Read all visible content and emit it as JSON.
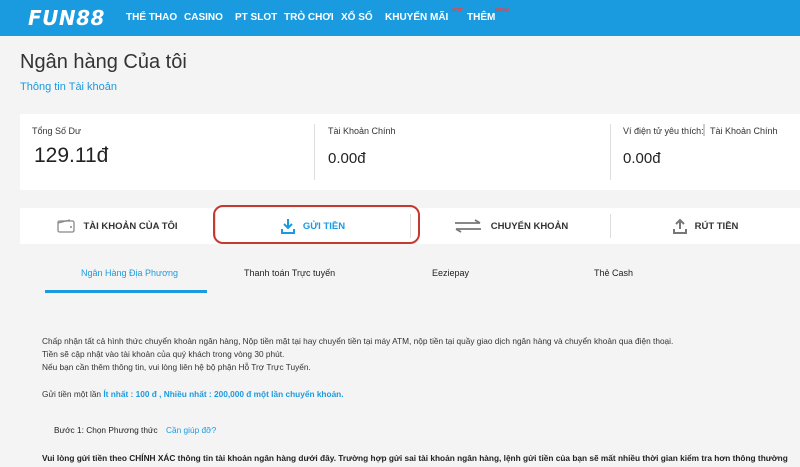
{
  "brand": {
    "logo_text": "FUN88",
    "accent": "#1a9be0",
    "highlight": "#c43a2e"
  },
  "nav": {
    "items": [
      {
        "label": "THỂ THAO"
      },
      {
        "label": "CASINO"
      },
      {
        "label": "PT SLOT"
      },
      {
        "label": "TRÒ CHƠI"
      },
      {
        "label": "XỔ SỐ"
      },
      {
        "label": "KHUYẾN MÃI",
        "badge": "HOT"
      },
      {
        "label": "THÊM",
        "badge": "NEW!"
      }
    ]
  },
  "header": {
    "title": "Ngân hàng Của tôi",
    "subtitle": "Thông tin Tài khoản"
  },
  "balances": {
    "total": {
      "label": "Tổng Số Dư",
      "value": "129.11đ"
    },
    "main": {
      "label": "Tài Khoản Chính",
      "value": "0.00đ"
    },
    "wallet": {
      "label": "Ví điện tử yêu thích:",
      "selected": "Tài Khoản Chính",
      "value": "0.00đ"
    }
  },
  "main_tabs": [
    {
      "label": "TÀI KHOẢN CỦA TÔI",
      "icon": "wallet-icon"
    },
    {
      "label": "GỬI TIỀN",
      "icon": "download-icon",
      "active": true
    },
    {
      "label": "CHUYỂN KHOẢN",
      "icon": "transfer-arrows-icon"
    },
    {
      "label": "RÚT TIỀN",
      "icon": "upload-icon"
    }
  ],
  "sub_tabs": [
    {
      "label": "Ngân Hàng Địa Phương",
      "active": true
    },
    {
      "label": "Thanh toán Trực tuyến"
    },
    {
      "label": "Eeziepay"
    },
    {
      "label": "Thẻ Cash"
    }
  ],
  "content": {
    "line1": "Chấp nhận tất cả hình thức chuyển khoản ngân hàng, Nộp tiền mặt tại hay chuyển tiền tại máy ATM, nộp tiền tại quầy giao dịch ngân hàng và chuyển khoản qua điện thoại.",
    "line2": "Tiền sẽ cập nhật vào tài khoản của quý khách trong vòng 30 phút.",
    "line3": "Nếu bạn cần thêm thông tin, vui lòng liên hệ bộ phận Hỗ Trợ Trực Tuyến.",
    "limit_prefix": "Gửi tiền một lần",
    "limit_value": "Ít nhất : 100 đ , Nhiều nhất : 200,000 đ một lần chuyển khoản.",
    "step_label": "Bước 1: Chọn Phương thức",
    "help_link": "Cần giúp đỡ?",
    "notice": "Vui lòng gửi tiền theo CHÍNH XÁC thông tin tài khoản ngân hàng dưới đây. Trường hợp gửi sai tài khoản ngân hàng, lệnh gửi tiền của bạn sẽ mất nhiều thời gian kiểm tra hơn thông thường"
  }
}
